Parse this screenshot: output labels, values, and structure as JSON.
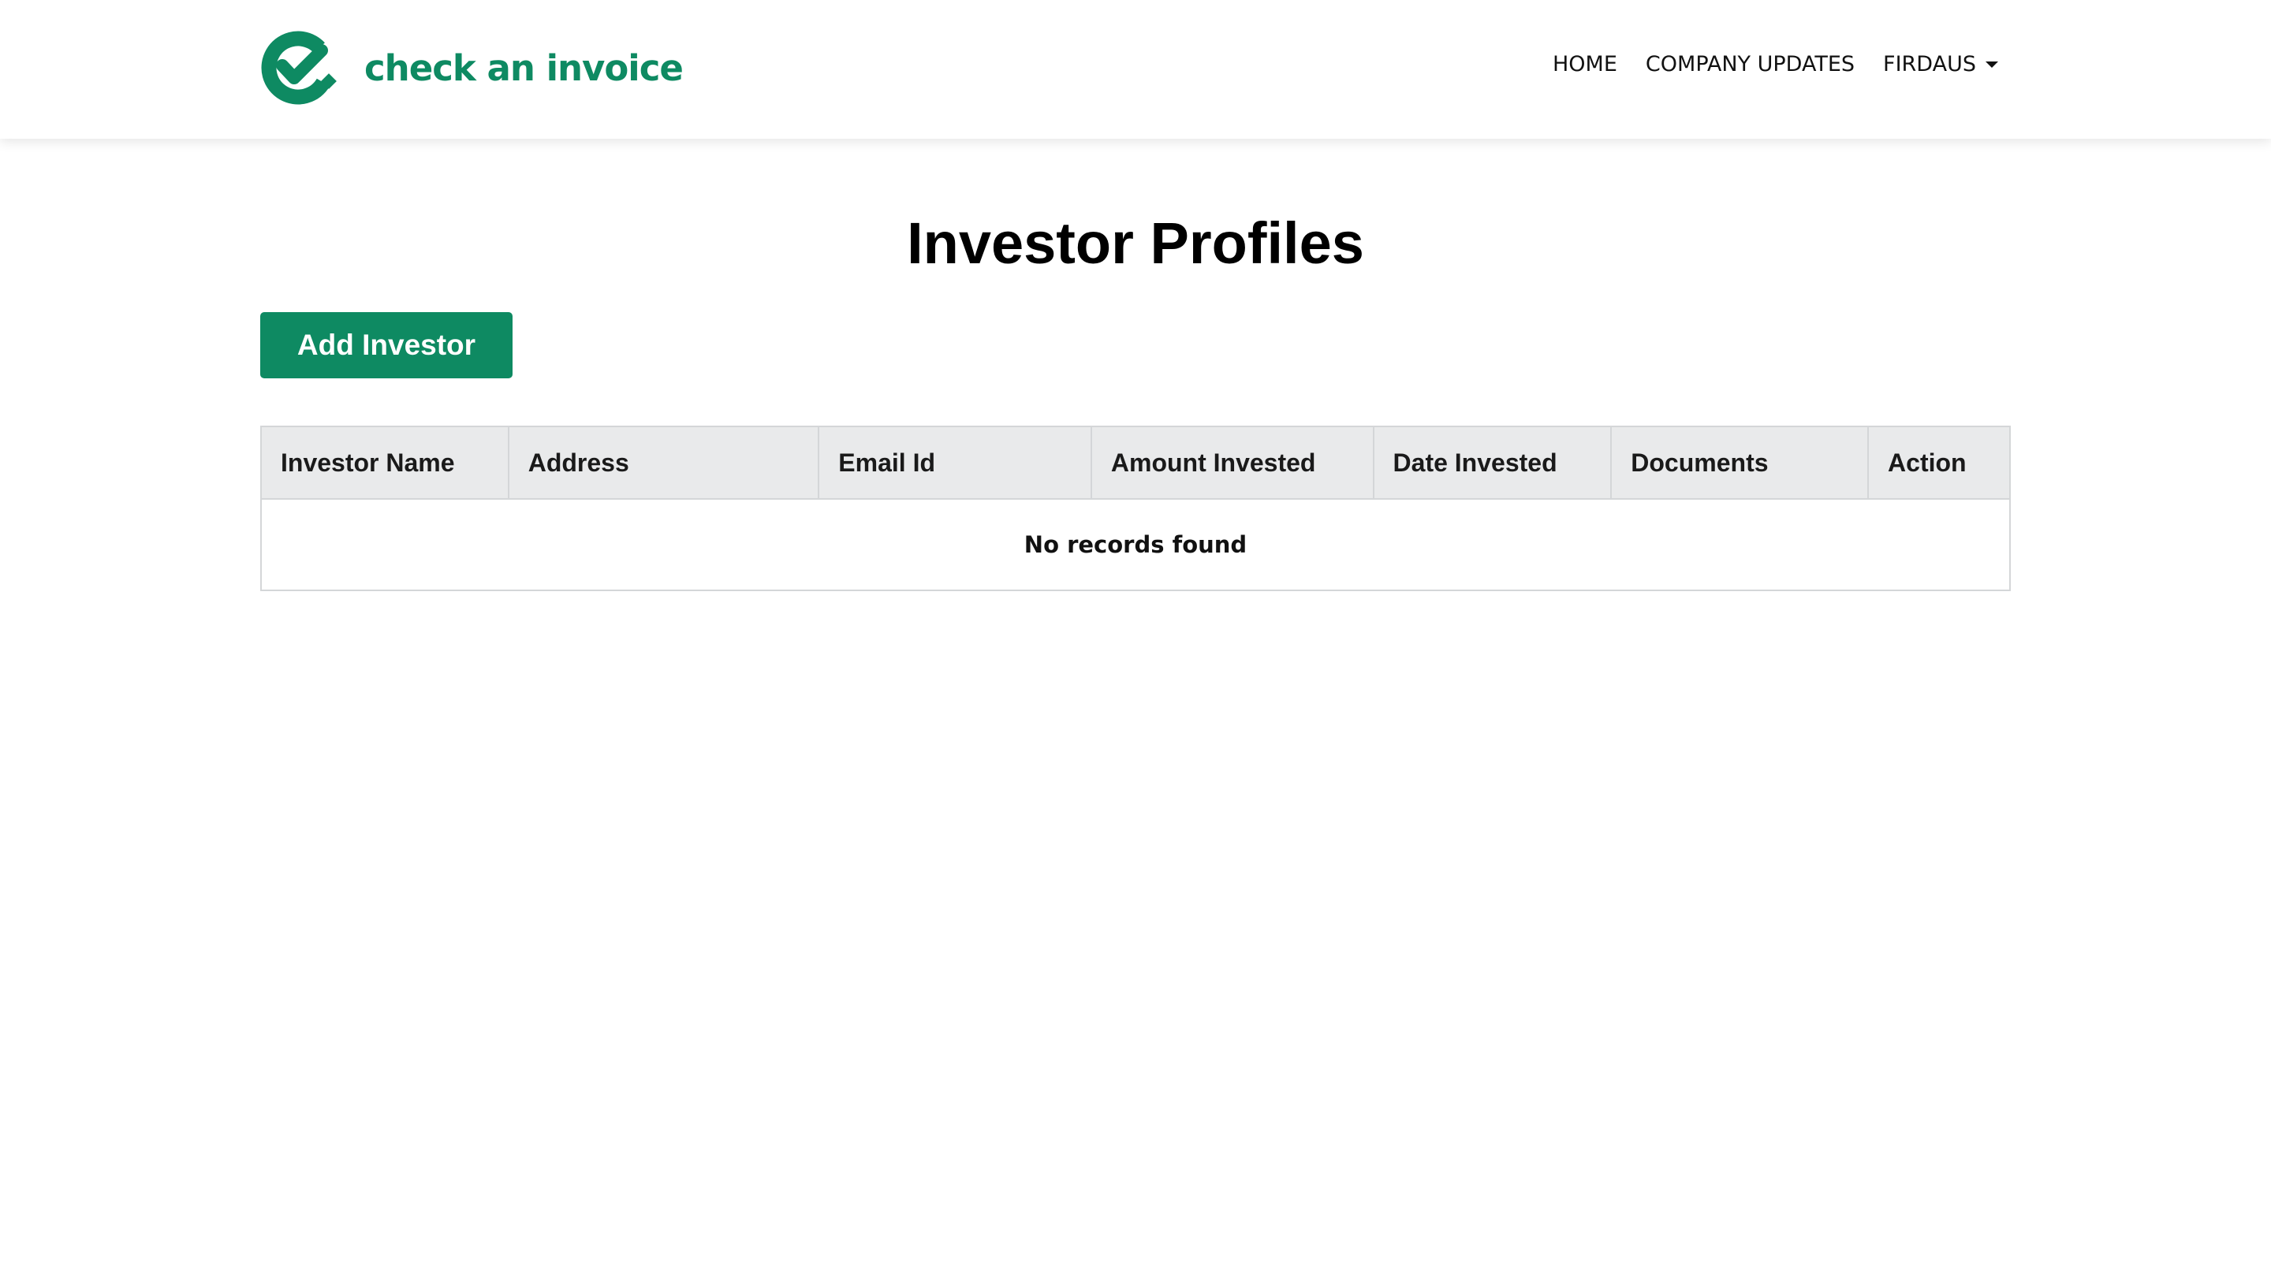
{
  "brand": {
    "name": "check an invoice",
    "color": "#0e8a62"
  },
  "nav": {
    "items": [
      "HOME",
      "COMPANY UPDATES"
    ],
    "user": "FIRDAUS"
  },
  "page": {
    "title": "Investor Profiles",
    "add_button": "Add Investor"
  },
  "table": {
    "columns": [
      "Investor Name",
      "Address",
      "Email Id",
      "Amount Invested",
      "Date Invested",
      "Documents",
      "Action"
    ],
    "empty_message": "No records found"
  }
}
